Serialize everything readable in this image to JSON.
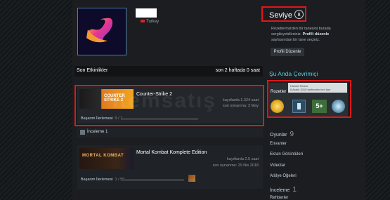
{
  "profile": {
    "country": "Turkey"
  },
  "level": {
    "label": "Seviye",
    "value": "8",
    "desc_pre": "Rozetlerinizden bir tanesini burada sergileyebilirsiniz. ",
    "desc_bold": "Profili düzenle",
    "desc_post": " sayfasından bir tane seçiniz.",
    "edit_button": "Profili Düzenle"
  },
  "activity": {
    "title": "Son Etkinlikler",
    "hours": "son 2 haftada 0 saat",
    "games": [
      {
        "name": "Counter-Strike 2",
        "image_text": "COUNTER STRIKE 2",
        "hours": "kayıtlarda 1.324 saat",
        "last_played": "son oynanma: 2 May",
        "ach_label": "Başarım İlerlemesi",
        "ach_count": "0 / 1"
      },
      {
        "name": "Mortal Kombat Komplete Edition",
        "image_text": "MORTAL KOMBAT",
        "hours": "kayıtlarda 2.5 saat",
        "last_played": "son oynanma: 29 Nis 2018",
        "ach_label": "Başarım İlerlemesi",
        "ach_count": "1 / 50"
      }
    ],
    "review": "İnceleme 1"
  },
  "online": {
    "title": "Şu Anda Çevrimiçi",
    "badges_label": "Rozetler",
    "tooltip_title": "Hizmet Süresi",
    "tooltip_text": "6 Aralık 2015 tarihinden beri üye",
    "badge_5": "5+"
  },
  "stats": {
    "games_label": "Oyunlar",
    "games_count": "9",
    "inventory": "Envanter",
    "screenshots": "Ekran Görüntüleri",
    "videos": "Videolar",
    "workshop": "Atölye Öğeleri",
    "reviews_label": "İnceleme",
    "reviews_count": "1",
    "guides": "Rehberler"
  },
  "watermark": "itemsatış",
  "colors": {
    "highlight": "#e0161b",
    "online_title": "#57cbde",
    "avatar_border": "#4e7fa6"
  }
}
